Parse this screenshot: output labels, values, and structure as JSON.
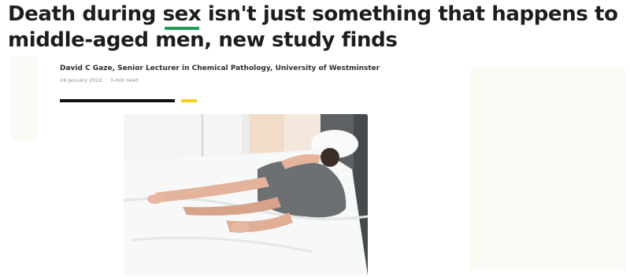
{
  "article": {
    "title_part1": "Death during ",
    "title_keyword": "sex",
    "title_part2": " isn't just something that happens to middle-aged men, new study finds",
    "byline": "David C Gaze, Senior Lecturer in Chemical Pathology, University of Westminster",
    "date": "24 January 2022",
    "separator": "·",
    "read_time": "3-min read",
    "accent_colors": {
      "keyword_underline": "#1f9d55",
      "divider_black": "#111111",
      "divider_yellow": "#f6cf1a"
    }
  },
  "image": {
    "kind": "photo",
    "icon": "photo-bedroom-couple"
  }
}
